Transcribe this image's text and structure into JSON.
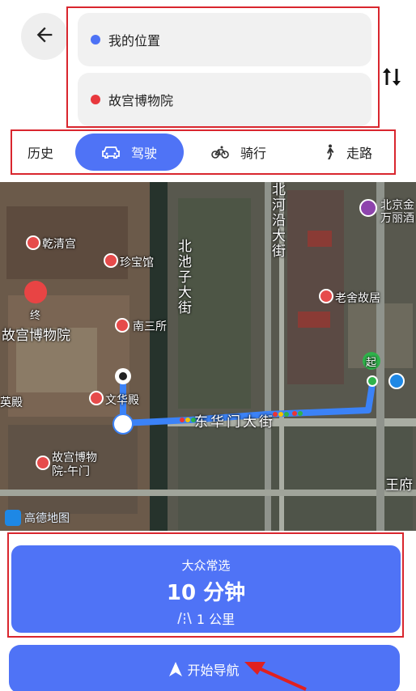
{
  "header": {
    "start_location": "我的位置",
    "end_location": "故宫博物院",
    "start_dot_color": "#4d72f5",
    "end_dot_color": "#e8383d"
  },
  "modes": {
    "history": "历史",
    "drive": "驾驶",
    "ride": "骑行",
    "walk": "走路",
    "active": "drive"
  },
  "map": {
    "labels": {
      "qianqinggong": "乾清宫",
      "zhenbaoguan": "珍宝馆",
      "gugong": "故宫博物院",
      "nansansuo": "南三所",
      "wenhuadian": "文华殿",
      "wumen": "故宫博物院-午门",
      "yingdian": "英殿",
      "beichizi": "北池子大街",
      "beiheyan": "北河沿大街",
      "donghuamen": "东华门大街",
      "laoshe": "老舍故居",
      "beijingjin": "北京金",
      "wanlijiu": "万丽酒",
      "wangfu": "王府",
      "zhong_marker": "终",
      "qi_marker": "起"
    },
    "watermark": "高德地图"
  },
  "route_card": {
    "tag": "大众常选",
    "time": "10 分钟",
    "distance": "1 公里"
  },
  "start_button": {
    "label": "开始导航"
  },
  "colors": {
    "accent": "#4f73f6",
    "annotation": "#d9262e"
  }
}
